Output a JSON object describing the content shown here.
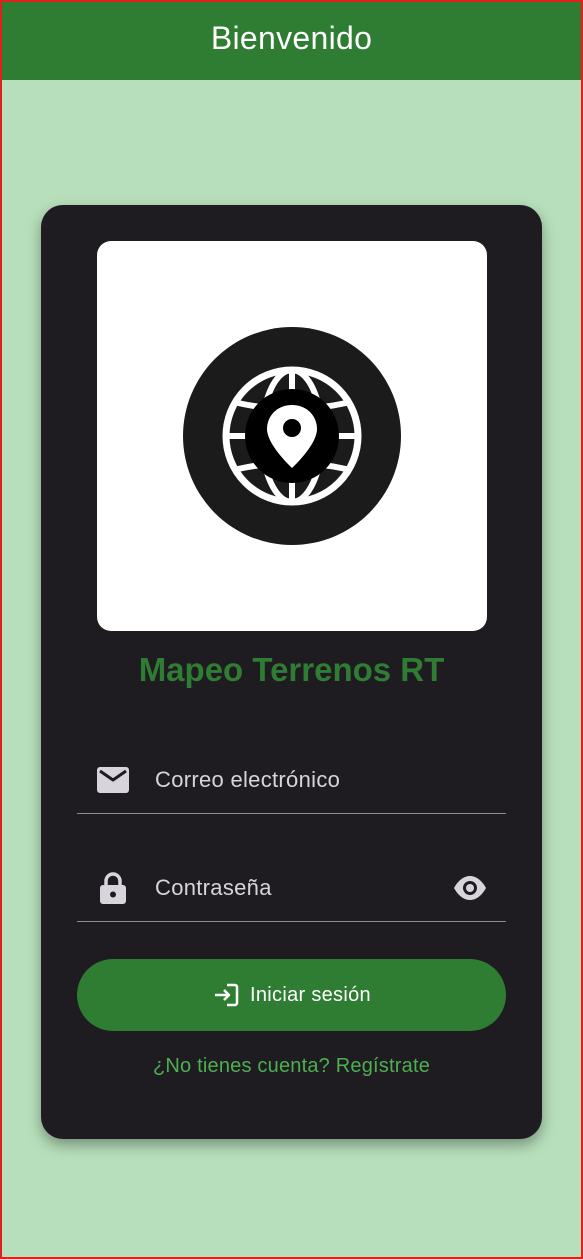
{
  "app_bar": {
    "title": "Bienvenido"
  },
  "logo": {
    "icon": "globe-location-pin-icon"
  },
  "app_name": "Mapeo Terrenos RT",
  "form": {
    "email": {
      "icon": "mail-icon",
      "placeholder": "Correo electrónico",
      "value": ""
    },
    "password": {
      "icon": "lock-icon",
      "placeholder": "Contraseña",
      "value": "",
      "toggle_icon": "eye-icon"
    }
  },
  "login_button": {
    "icon": "login-icon",
    "label": "Iniciar sesión"
  },
  "register_link": "¿No tienes cuenta? Regístrate",
  "colors": {
    "background": "#b7dfbb",
    "primary": "#2e7d32",
    "card": "#1e1c21",
    "link": "#4caf50",
    "frame": "#e0201a"
  }
}
